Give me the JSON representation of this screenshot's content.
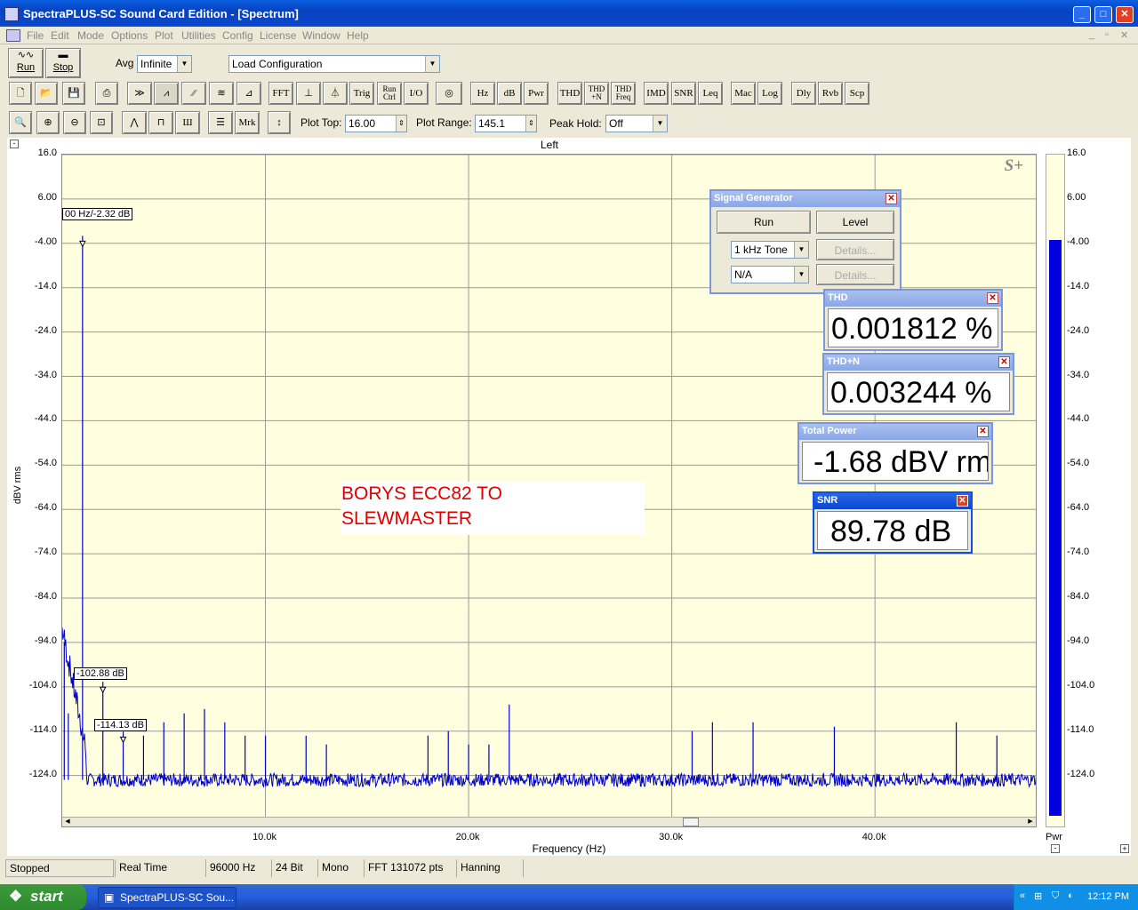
{
  "window": {
    "title": "SpectraPLUS-SC Sound Card Edition - [Spectrum]"
  },
  "menu": [
    "File",
    "Edit",
    "Mode",
    "Options",
    "Plot",
    "Utilities",
    "Config",
    "License",
    "Window",
    "Help"
  ],
  "toolbar1": {
    "run": "Run",
    "stop": "Stop",
    "avg_label": "Avg",
    "avg_value": "Infinite",
    "config_value": "Load Configuration"
  },
  "toolbar2": [
    "FFT",
    "Trig",
    "Run Ctrl",
    "I/O",
    "Hz",
    "dB",
    "Pwr",
    "THD",
    "THD +N",
    "THD Freq",
    "IMD",
    "SNR",
    "Leq",
    "Mac",
    "Log",
    "Dly",
    "Rvb",
    "Scp"
  ],
  "toolbar3": {
    "mrk": "Mrk",
    "plot_top_label": "Plot Top:",
    "plot_top_value": "16.00",
    "plot_range_label": "Plot Range:",
    "plot_range_value": "145.1",
    "peak_hold_label": "Peak Hold:",
    "peak_hold_value": "Off"
  },
  "plot": {
    "channel": "Left",
    "ylabel": "dBV rms",
    "xlabel": "Frequency (Hz)",
    "meter_label": "Pwr",
    "logo": "S+",
    "yticks": [
      "16.0",
      "6.00",
      "-4.00",
      "-14.0",
      "-24.0",
      "-34.0",
      "-44.0",
      "-54.0",
      "-64.0",
      "-74.0",
      "-84.0",
      "-94.0",
      "-104.0",
      "-114.0",
      "-124.0"
    ],
    "xticks": [
      "10.0k",
      "20.0k",
      "30.0k",
      "40.0k"
    ],
    "markers": [
      "00 Hz/-2.32 dB",
      "-102.88 dB",
      "-114.13 dB"
    ],
    "note_line1": "BORYS ECC82 TO",
    "note_line2": "SLEWMASTER"
  },
  "chart_data": {
    "type": "line",
    "xlabel": "Frequency (Hz)",
    "ylabel": "dBV rms",
    "ylim": [
      -129.1,
      16.0
    ],
    "xlim": [
      0,
      48000
    ],
    "meter_value": -2.3,
    "series": [
      {
        "values": [
          [
            100,
            -94
          ],
          [
            300,
            -110
          ],
          [
            1000,
            -2.32
          ],
          [
            2000,
            -102.88
          ],
          [
            3000,
            -114.13
          ],
          [
            4000,
            -115
          ],
          [
            5000,
            -112
          ],
          [
            6000,
            -110
          ],
          [
            7000,
            -109
          ],
          [
            8000,
            -112
          ],
          [
            9000,
            -115
          ],
          [
            10000,
            -115
          ],
          [
            12000,
            -115
          ],
          [
            13000,
            -117
          ],
          [
            18000,
            -115
          ],
          [
            19000,
            -114
          ],
          [
            20000,
            -117
          ],
          [
            21000,
            -117
          ],
          [
            22000,
            -108
          ],
          [
            31000,
            -114
          ],
          [
            32000,
            -112
          ],
          [
            34000,
            -112
          ],
          [
            38000,
            -113
          ],
          [
            44000,
            -112
          ],
          [
            46000,
            -115
          ]
        ],
        "floor": -125
      }
    ]
  },
  "signal_generator": {
    "title": "Signal Generator",
    "run": "Run",
    "level": "Level",
    "tone": "1 kHz Tone",
    "details": "Details...",
    "second": "N/A"
  },
  "readouts": {
    "thd_title": "THD",
    "thd_value": "0.001812 %",
    "thdn_title": "THD+N",
    "thdn_value": "0.003244 %",
    "power_title": "Total Power",
    "power_value": "-1.68 dBV rm",
    "snr_title": "SNR",
    "snr_value": "89.78 dB"
  },
  "status": [
    "Stopped",
    "Real Time",
    "96000 Hz",
    "24 Bit",
    "Mono",
    "FFT 131072 pts",
    "Hanning"
  ],
  "taskbar": {
    "start": "start",
    "task": "SpectraPLUS-SC Sou...",
    "clock": "12:12 PM"
  }
}
